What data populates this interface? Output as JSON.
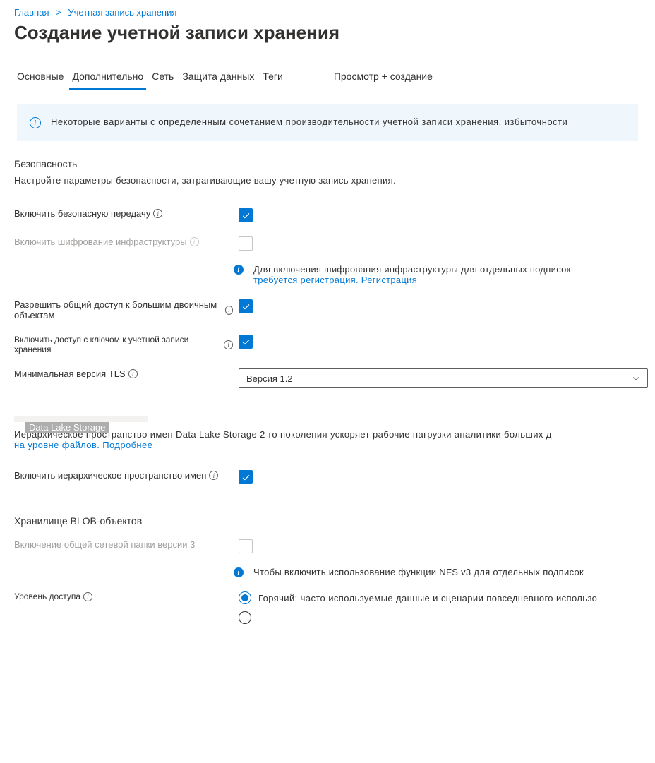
{
  "breadcrumb": {
    "home": "Главная",
    "current": "Учетная запись хранения"
  },
  "page_title": "Создание учетной записи хранения",
  "tabs": {
    "basics": "Основные",
    "advanced": "Дополнительно",
    "network": "Сеть",
    "data_protection": "Защита данных",
    "tags": "Теги",
    "review": "Просмотр + создание"
  },
  "banner_text": "Некоторые варианты с определенным сочетанием производительности учетной записи хранения, избыточности",
  "security": {
    "heading": "Безопасность",
    "description": "Настройте параметры безопасности, затрагивающие вашу учетную запись хранения.",
    "secure_transfer_label": "Включить безопасную передачу",
    "infra_encrypt_label": "Включить шифрование инфраструктуры",
    "infra_note_text": "Для включения шифрования инфраструктуры для отдельных подписок ",
    "infra_note_link": "требуется регистрация. Регистрация",
    "blob_public_label": "Разрешить общий доступ к большим двоичным объектам",
    "key_access_label": "Включить доступ с ключом к учетной записи хранения",
    "tls_label": "Минимальная версия TLS",
    "tls_value": "Версия 1.2"
  },
  "dls": {
    "badge": "Data Lake Storage",
    "description": "Иерархическое пространство имен Data Lake Storage 2-го поколения ускоряет рабочие нагрузки аналитики больших д",
    "link": "на уровне файлов. Подробнее",
    "hns_label": "Включить иерархическое пространство имен"
  },
  "blob": {
    "heading": "Хранилище BLOB-объектов",
    "nfs_label": "Включение общей сетевой папки версии 3",
    "nfs_note": "Чтобы включить использование функции NFS v3 для отдельных подписок",
    "tier_label": "Уровень доступа",
    "tier_hot": "Горячий: часто используемые данные и сценарии повседневного использо"
  }
}
